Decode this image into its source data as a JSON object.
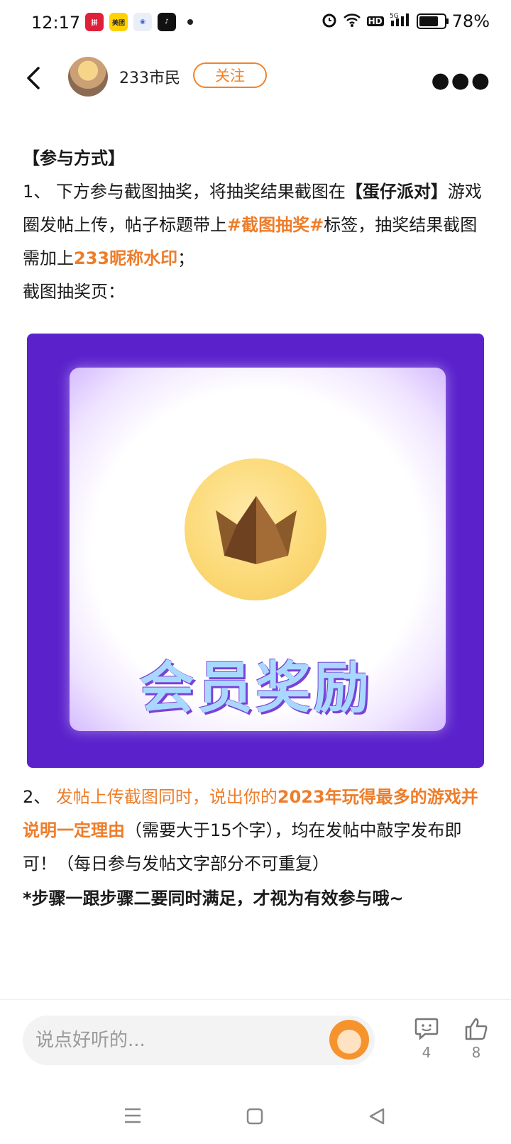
{
  "status_bar": {
    "time": "12:17",
    "battery": "78%",
    "battery_level": 0.78,
    "network": "5G",
    "hd": "HD"
  },
  "header": {
    "username": "233市民",
    "follow_label": "关注"
  },
  "content": {
    "section_title": "【参与方式】",
    "step1_a": "1、 下方参与截图抽奖，将抽奖结果截图在",
    "step1_b": "【蛋仔派对】",
    "step1_c": "游戏圈发帖上传，帖子标题带上",
    "step1_tag": "#截图抽奖#",
    "step1_d": "标签，抽奖结果截图需加上",
    "step1_watermark": "233昵称水印",
    "step1_e": "；",
    "screenshot_label": "截图抽奖页：",
    "reward_title": "会员奖励",
    "step2_num": "2、 ",
    "step2_hl_a": "发帖上传截图同时，说出你的",
    "step2_hl_b": "2023年玩得最多的",
    "step2_hl_c": "游戏并说明一定理由",
    "step2_rest": "（需要大于15个字），均在发帖中敲字发布即可！（每日参与发帖文字部分不可重复）",
    "note": "*步骤一跟步骤二要同时满足，才视为有效参与哦~"
  },
  "bottom": {
    "comment_placeholder": "说点好听的...",
    "comment_count": "4",
    "like_count": "8"
  },
  "colors": {
    "accent": "#ee7d2a",
    "reward_bg": "#5b22cc"
  }
}
